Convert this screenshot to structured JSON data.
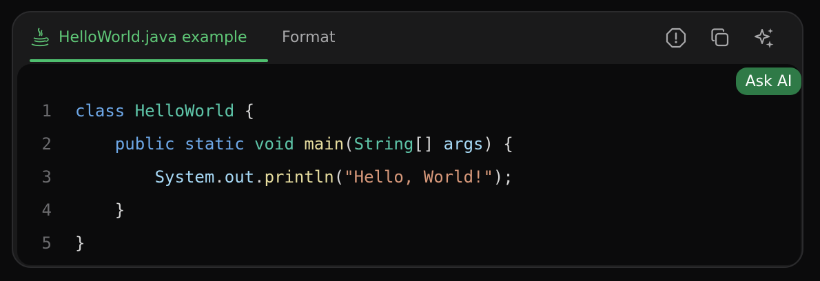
{
  "tabs": {
    "active_label": "HelloWorld.java example",
    "format_label": "Format"
  },
  "actions": {
    "report_icon": "report-icon",
    "copy_icon": "copy-icon",
    "sparkle_icon": "sparkle-icon",
    "ask_ai_label": "Ask AI"
  },
  "code": {
    "line_numbers": [
      "1",
      "2",
      "3",
      "4",
      "5"
    ],
    "l1": {
      "kw": "class",
      "name": "HelloWorld",
      "brace": "{"
    },
    "l2": {
      "kw1": "public",
      "kw2": "static",
      "type": "void",
      "fn": "main",
      "open": "(",
      "param_type": "String",
      "brackets": "[]",
      "param": "args",
      "close": ")",
      "brace": "{"
    },
    "l3": {
      "obj": "System",
      "dot1": ".",
      "field": "out",
      "dot2": ".",
      "fn": "println",
      "open": "(",
      "str": "\"Hello, World!\"",
      "close": ");"
    },
    "l4": {
      "brace": "}"
    },
    "l5": {
      "brace": "}"
    }
  },
  "colors": {
    "accent": "#5fc777",
    "ask_ai_bg": "#2f7a47",
    "keyword": "#6ea8e8",
    "class_name": "#5ec4a8",
    "function": "#e6dc9e",
    "string": "#d7987a"
  }
}
